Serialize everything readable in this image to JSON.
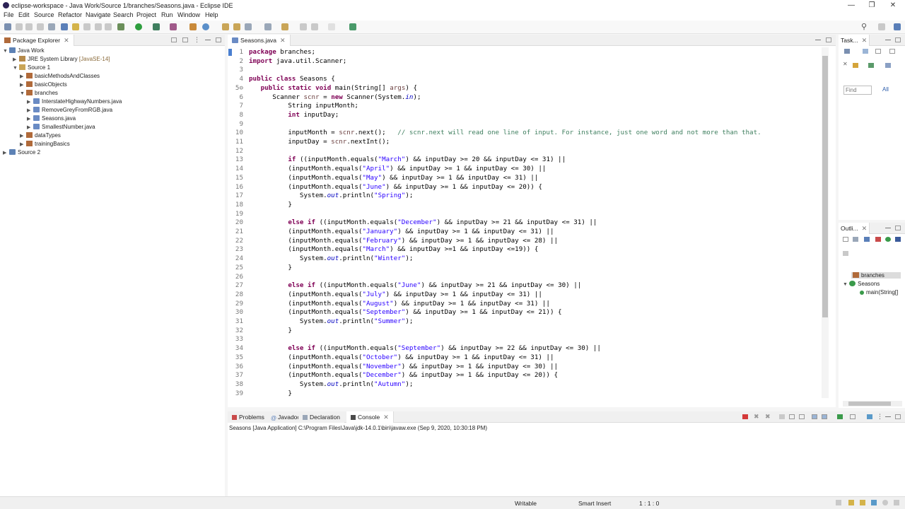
{
  "window": {
    "title": "eclipse-workspace - Java Work/Source 1/branches/Seasons.java - Eclipse IDE"
  },
  "menu": [
    "File",
    "Edit",
    "Source",
    "Refactor",
    "Navigate",
    "Search",
    "Project",
    "Run",
    "Window",
    "Help"
  ],
  "package_explorer": {
    "title": "Package Explorer",
    "tree": {
      "java_work": "Java Work",
      "jre_label": "JRE System Library",
      "jre_tag": "[JavaSE-14]",
      "source1": "Source 1",
      "pkg_basic_methods": "basicMethodsAndClasses",
      "pkg_basic_objects": "basicObjects",
      "pkg_branches": "branches",
      "file_interstate": "InterstateHighwayNumbers.java",
      "file_removegrey": "RemoveGreyFromRGB.java",
      "file_seasons": "Seasons.java",
      "file_smallest": "SmallestNumber.java",
      "pkg_datatypes": "dataTypes",
      "pkg_training": "trainingBasics",
      "source2": "Source 2"
    }
  },
  "editor": {
    "tab": "Seasons.java",
    "lines": [
      {
        "n": "1",
        "t": "package branches;"
      },
      {
        "n": "2",
        "t": "import java.util.Scanner;"
      },
      {
        "n": "3",
        "t": ""
      },
      {
        "n": "4",
        "t": "public class Seasons {"
      },
      {
        "n": "5⊖",
        "t": "   public static void main(String[] args) {"
      },
      {
        "n": "6",
        "t": "      Scanner scnr = new Scanner(System.in);"
      },
      {
        "n": "7",
        "t": "          String inputMonth;"
      },
      {
        "n": "8",
        "t": "          int inputDay;"
      },
      {
        "n": "9",
        "t": ""
      },
      {
        "n": "10",
        "t": "          inputMonth = scnr.next();   // scnr.next will read one line of input. For instance, just one word and not more than that."
      },
      {
        "n": "11",
        "t": "          inputDay = scnr.nextInt();"
      },
      {
        "n": "12",
        "t": ""
      },
      {
        "n": "13",
        "t": "          if ((inputMonth.equals(\"March\") && inputDay >= 20 && inputDay <= 31) ||"
      },
      {
        "n": "14",
        "t": "          (inputMonth.equals(\"April\") && inputDay >= 1 && inputDay <= 30) ||"
      },
      {
        "n": "15",
        "t": "          (inputMonth.equals(\"May\") && inputDay >= 1 && inputDay <= 31) ||"
      },
      {
        "n": "16",
        "t": "          (inputMonth.equals(\"June\") && inputDay >= 1 && inputDay <= 20)) {"
      },
      {
        "n": "17",
        "t": "             System.out.println(\"Spring\");"
      },
      {
        "n": "18",
        "t": "          }"
      },
      {
        "n": "19",
        "t": ""
      },
      {
        "n": "20",
        "t": "          else if ((inputMonth.equals(\"December\") && inputDay >= 21 && inputDay <= 31) ||"
      },
      {
        "n": "21",
        "t": "          (inputMonth.equals(\"January\") && inputDay >= 1 && inputDay <= 31) ||"
      },
      {
        "n": "22",
        "t": "          (inputMonth.equals(\"February\") && inputDay >= 1 && inputDay <= 28) ||"
      },
      {
        "n": "23",
        "t": "          (inputMonth.equals(\"March\") && inputDay >=1 && inputDay <=19)) {"
      },
      {
        "n": "24",
        "t": "             System.out.println(\"Winter\");"
      },
      {
        "n": "25",
        "t": "          }"
      },
      {
        "n": "26",
        "t": ""
      },
      {
        "n": "27",
        "t": "          else if ((inputMonth.equals(\"June\") && inputDay >= 21 && inputDay <= 30) ||"
      },
      {
        "n": "28",
        "t": "          (inputMonth.equals(\"July\") && inputDay >= 1 && inputDay <= 31) ||"
      },
      {
        "n": "29",
        "t": "          (inputMonth.equals(\"August\") && inputDay >= 1 && inputDay <= 31) ||"
      },
      {
        "n": "30",
        "t": "          (inputMonth.equals(\"September\") && inputDay >= 1 && inputDay <= 21)) {"
      },
      {
        "n": "31",
        "t": "             System.out.println(\"Summer\");"
      },
      {
        "n": "32",
        "t": "          }"
      },
      {
        "n": "33",
        "t": ""
      },
      {
        "n": "34",
        "t": "          else if ((inputMonth.equals(\"September\") && inputDay >= 22 && inputDay <= 30) ||"
      },
      {
        "n": "35",
        "t": "          (inputMonth.equals(\"October\") && inputDay >= 1 && inputDay <= 31) ||"
      },
      {
        "n": "36",
        "t": "          (inputMonth.equals(\"November\") && inputDay >= 1 && inputDay <= 30) ||"
      },
      {
        "n": "37",
        "t": "          (inputMonth.equals(\"December\") && inputDay >= 1 && inputDay <= 20)) {"
      },
      {
        "n": "38",
        "t": "             System.out.println(\"Autumn\");"
      },
      {
        "n": "39",
        "t": "          }"
      }
    ]
  },
  "task_panel": {
    "title": "Task...",
    "find_placeholder": "Find",
    "all_label": "All"
  },
  "outline_panel": {
    "title": "Outli...",
    "pkg": "branches",
    "cls": "Seasons",
    "method": "main(String[]"
  },
  "bottom": {
    "tabs": {
      "problems": "Problems",
      "javadoc": "Javadoc",
      "declaration": "Declaration",
      "console": "Console"
    },
    "console_header": "Seasons [Java Application] C:\\Program Files\\Java\\jdk-14.0.1\\bin\\javaw.exe  (Sep 9, 2020, 10:30:18 PM)"
  },
  "status": {
    "writable": "Writable",
    "insert_mode": "Smart Insert",
    "position": "1 : 1 : 0"
  }
}
